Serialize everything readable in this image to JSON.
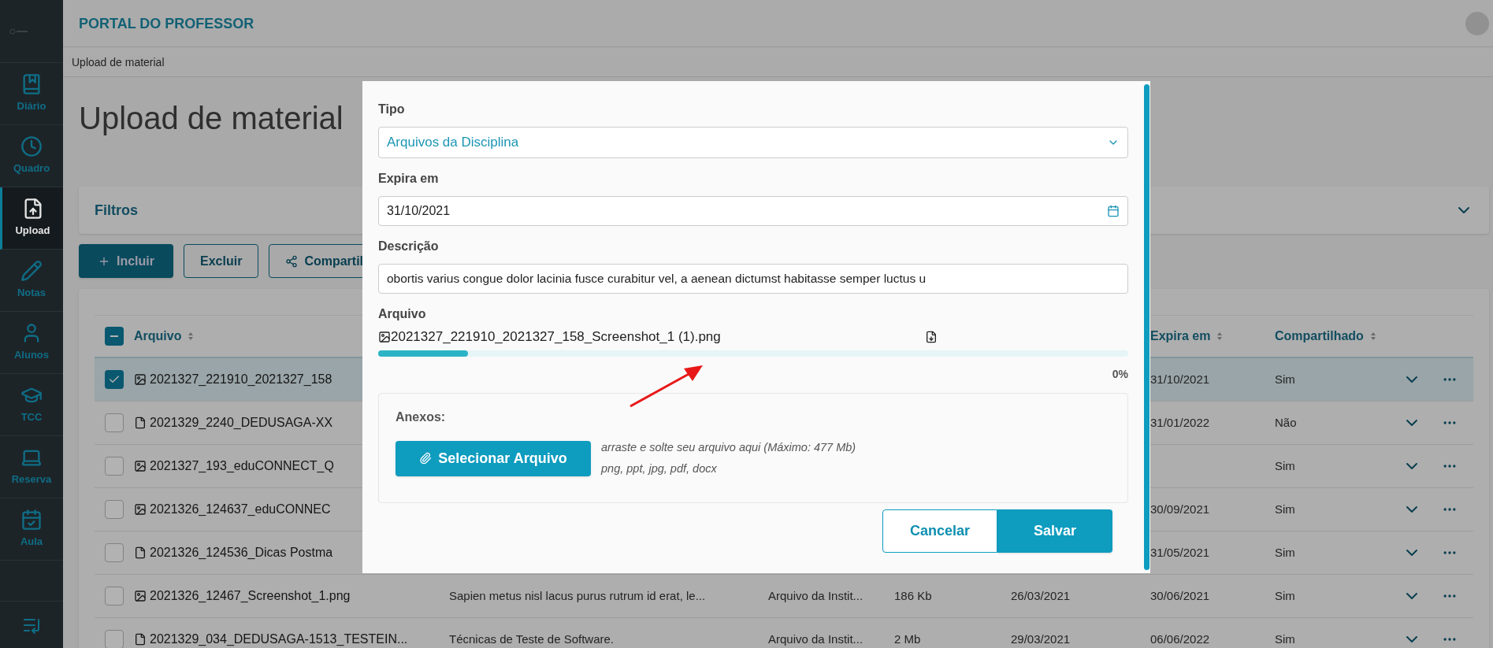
{
  "sidebar": {
    "items": [
      {
        "label": "Diário",
        "selected": false
      },
      {
        "label": "Quadro",
        "selected": false
      },
      {
        "label": "Upload",
        "selected": true
      },
      {
        "label": "Notas",
        "selected": false
      },
      {
        "label": "Alunos",
        "selected": false
      },
      {
        "label": "TCC",
        "selected": false
      },
      {
        "label": "Reserva",
        "selected": false
      },
      {
        "label": "Aula",
        "selected": false
      }
    ]
  },
  "header": {
    "title": "PORTAL DO PROFESSOR"
  },
  "breadcrumb": "Upload de material",
  "page_title": "Upload de material",
  "filters": {
    "title": "Filtros"
  },
  "actions": [
    {
      "label": "Incluir",
      "kind": "primary"
    },
    {
      "label": "Excluir",
      "kind": "outline"
    },
    {
      "label": "Compartil",
      "kind": "share"
    }
  ],
  "table": {
    "select_all": {
      "indeterminate": true
    },
    "columns": [
      {
        "label": "Arquivo"
      },
      {
        "label": "Expira em"
      },
      {
        "label": "Compartilhado"
      }
    ],
    "rows": [
      {
        "selected": true,
        "checked": true,
        "kind": "image",
        "name": "2021327_221910_2021327_158",
        "expira": "31/10/2021",
        "compartilhado": "Sim"
      },
      {
        "selected": false,
        "checked": false,
        "kind": "document",
        "name": "2021329_2240_DEDUSAGA-XX",
        "expira": "31/01/2022",
        "compartilhado": "Não"
      },
      {
        "selected": false,
        "checked": false,
        "kind": "image",
        "name": "2021327_193_eduCONNECT_Q",
        "compartilhado": "Sim"
      },
      {
        "selected": false,
        "checked": false,
        "kind": "image",
        "name": "2021326_124637_eduCONNEC",
        "expira": "30/09/2021",
        "compartilhado": "Sim"
      },
      {
        "selected": false,
        "checked": false,
        "kind": "document",
        "name": "2021326_124536_Dicas Postma",
        "expira": "31/05/2021",
        "compartilhado": "Sim"
      },
      {
        "selected": false,
        "checked": false,
        "kind": "image",
        "name": "2021326_12467_Screenshot_1.png",
        "descricao": "Sapien metus nisl lacus purus rutrum id erat, le...",
        "tipo": "Arquivo da Instit...",
        "tamanho": "186 Kb",
        "data": "26/03/2021",
        "expira": "30/06/2021",
        "compartilhado": "Sim"
      },
      {
        "selected": false,
        "checked": false,
        "kind": "document",
        "name": "2021329_034_DEDUSAGA-1513_TESTEIN...",
        "descricao": "Técnicas de Teste de Software.",
        "tipo": "Arquivo da Instit...",
        "tamanho": "2 Mb",
        "data": "29/03/2021",
        "expira": "06/06/2022",
        "compartilhado": "Sim"
      }
    ]
  },
  "modal": {
    "tipo": {
      "label": "Tipo",
      "value": "Arquivos da Disciplina"
    },
    "expira": {
      "label": "Expira em",
      "value": "31/10/2021"
    },
    "descricao": {
      "label": "Descrição",
      "value": "obortis varius congue dolor lacinia fusce curabitur vel, a aenean dictumst habitasse semper luctus u"
    },
    "arquivo": {
      "label": "Arquivo",
      "file_name": "2021327_221910_2021327_158_Screenshot_1 (1).png",
      "level": 0.12,
      "percent": "0%"
    },
    "anexos": {
      "title": "Anexos:",
      "button": "Selecionar Arquivo",
      "hint": "arraste e solte seu arquivo aqui (Máximo: 477 Mb)",
      "formats": "png, ppt, jpg, pdf, docx"
    },
    "buttons": [
      {
        "label": "Cancelar",
        "kind": "outline"
      },
      {
        "label": "Salvar",
        "kind": "primary"
      }
    ]
  }
}
